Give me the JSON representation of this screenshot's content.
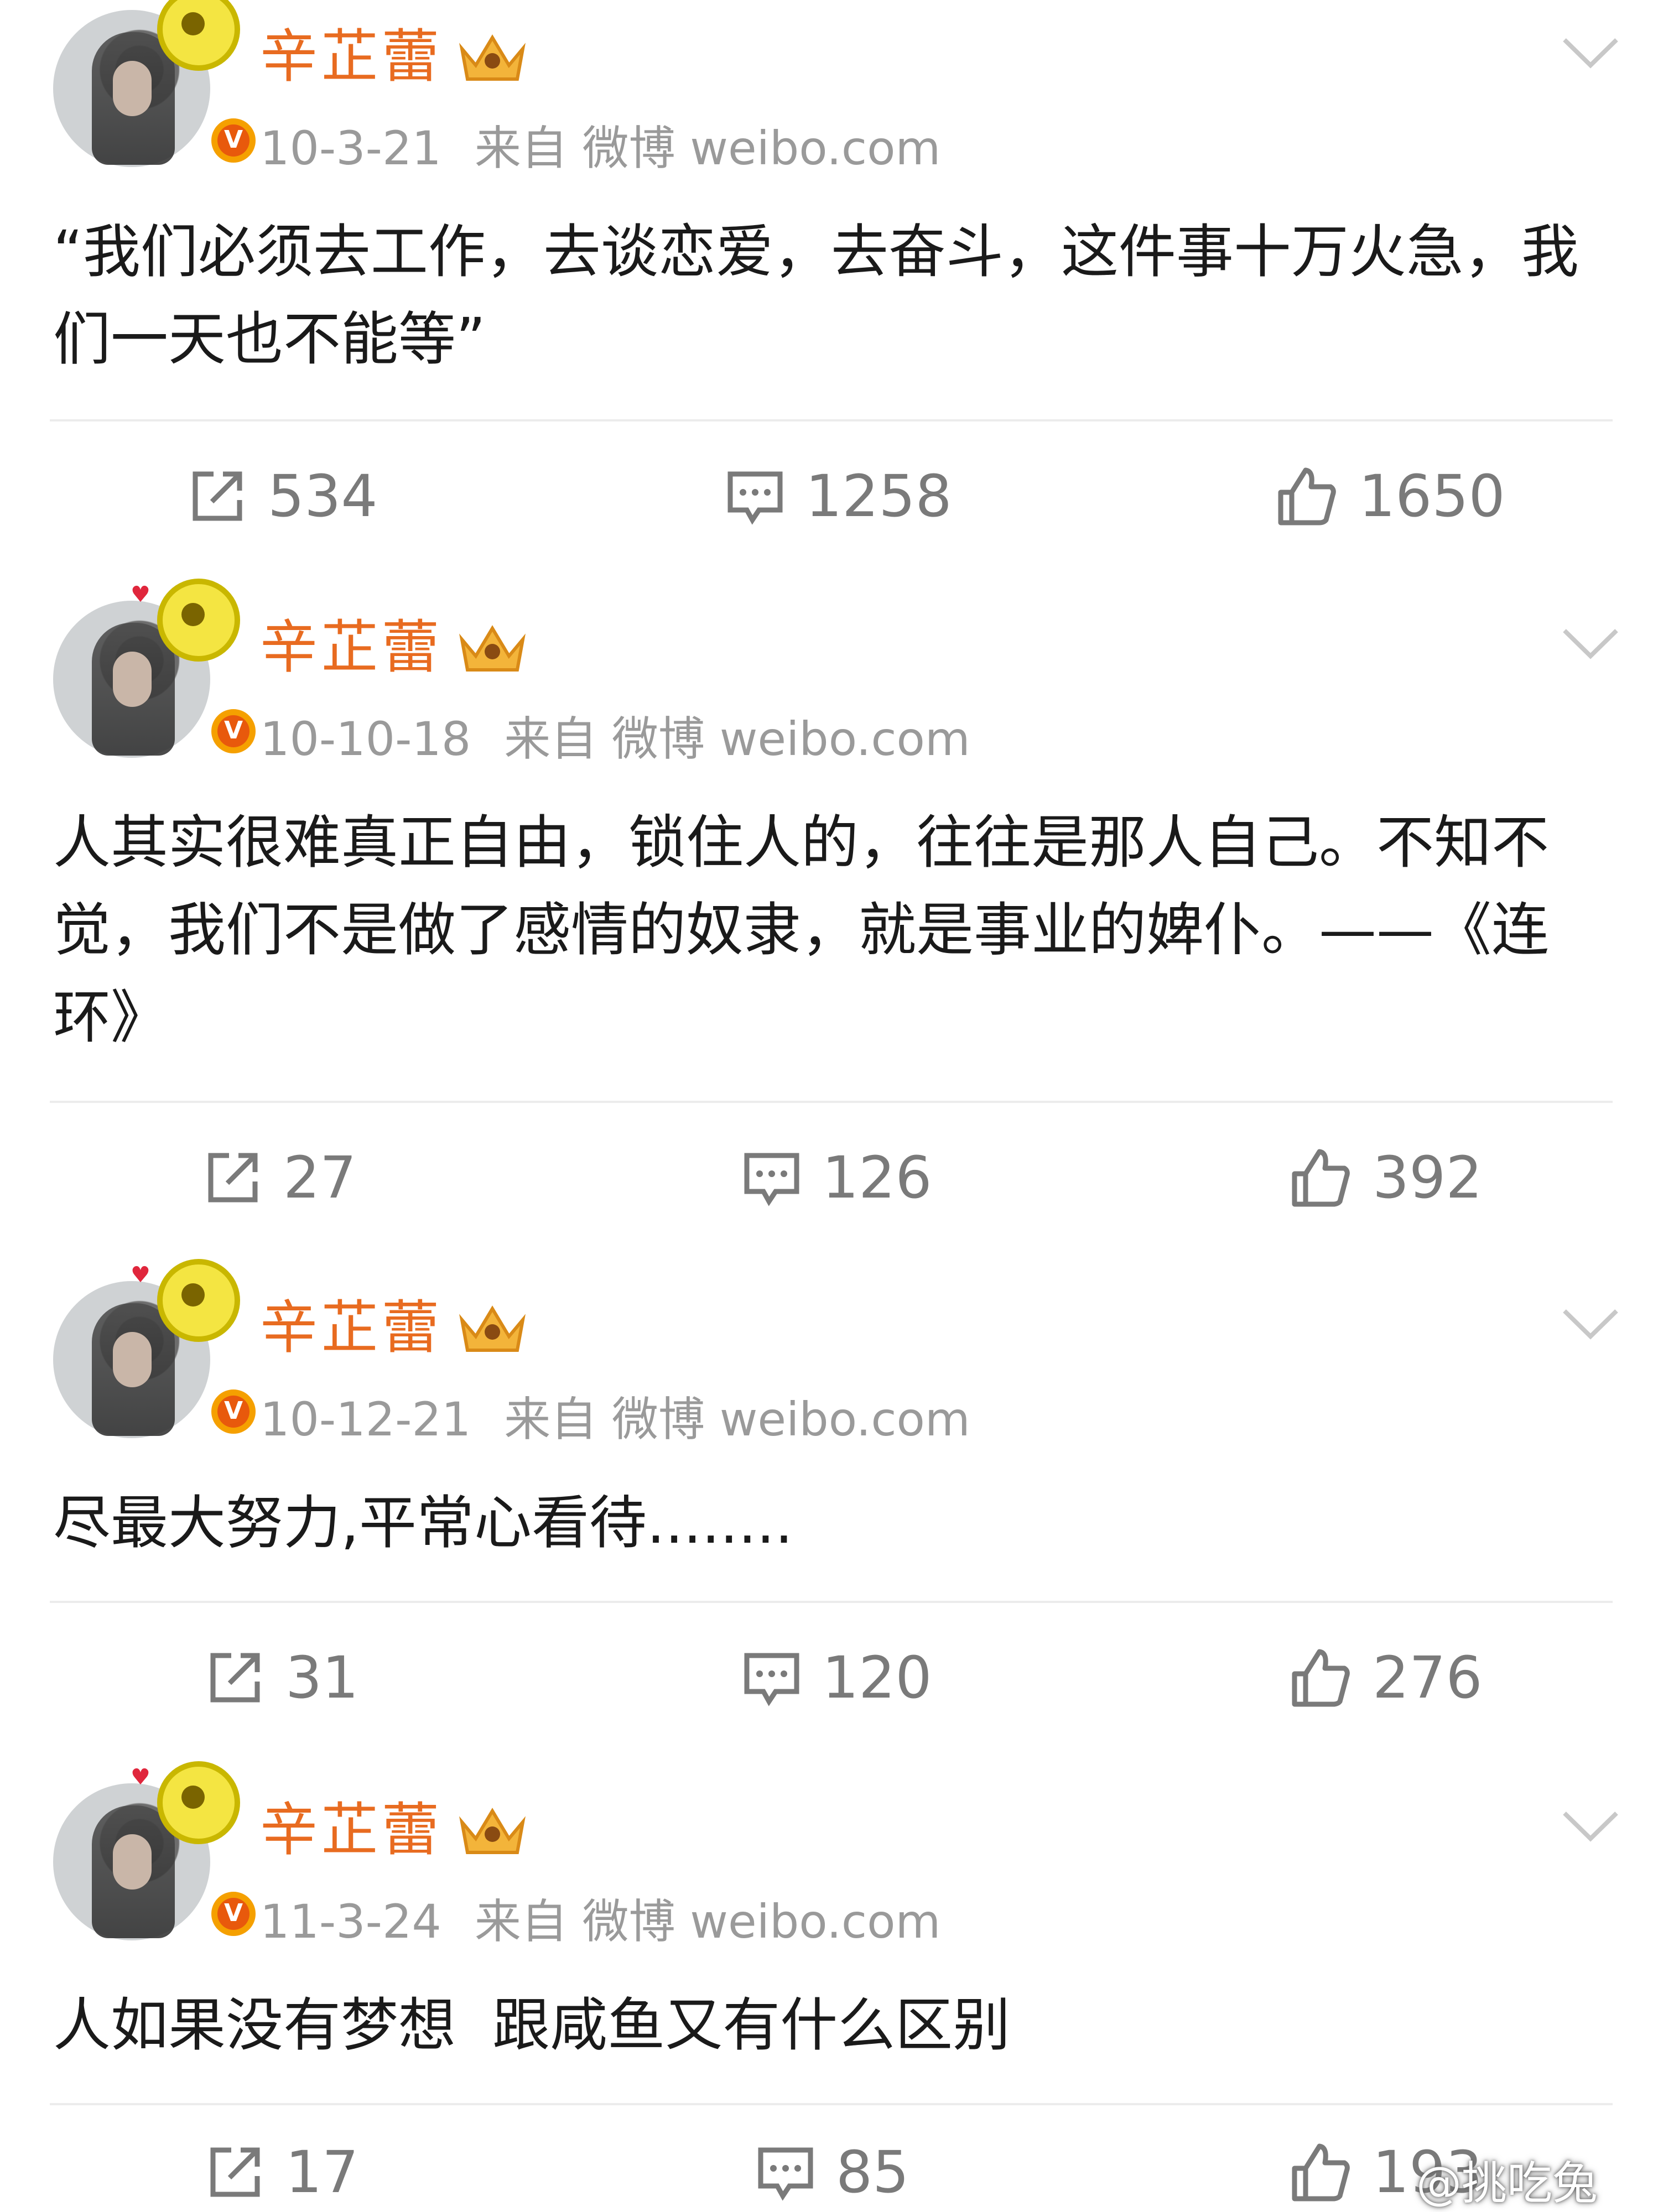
{
  "posts": [
    {
      "author": "辛芷蕾",
      "date": "10-3-21",
      "source_prefix": "来自",
      "source": "微博 weibo.com",
      "content": "“我们必须去工作，去谈恋爱，去奋斗，这件事十万火急，我们一天也不能等”",
      "reposts": "534",
      "comments": "1258",
      "likes": "1650"
    },
    {
      "author": "辛芷蕾",
      "date": "10-10-18",
      "source_prefix": "来自",
      "source": "微博 weibo.com",
      "content": "人其实很难真正自由，锁住人的，往往是那人自己。不知不觉，我们不是做了感情的奴隶，就是事业的婢仆。——《连环》",
      "reposts": "27",
      "comments": "126",
      "likes": "392"
    },
    {
      "author": "辛芷蕾",
      "date": "10-12-21",
      "source_prefix": "来自",
      "source": "微博 weibo.com",
      "content": "尽最大努力,平常心看待........",
      "reposts": "31",
      "comments": "120",
      "likes": "276"
    },
    {
      "author": "辛芷蕾",
      "date": "11-3-24",
      "source_prefix": "来自",
      "source": "微博 weibo.com",
      "content": "人如果没有梦想  跟咸鱼又有什么区别",
      "reposts": "17",
      "comments": "85",
      "likes": "193"
    }
  ],
  "watermark": "@挑吃兔",
  "icons": {
    "verified_badge": "v-badge-icon",
    "member_crown": "crown-icon",
    "menu": "chevron-down-icon",
    "repost": "share-icon",
    "comment": "comment-icon",
    "like": "thumbs-up-icon"
  },
  "colors": {
    "author_name": "#e86b20",
    "meta_text": "#9a9a9a",
    "action_text": "#7a7a7a"
  }
}
